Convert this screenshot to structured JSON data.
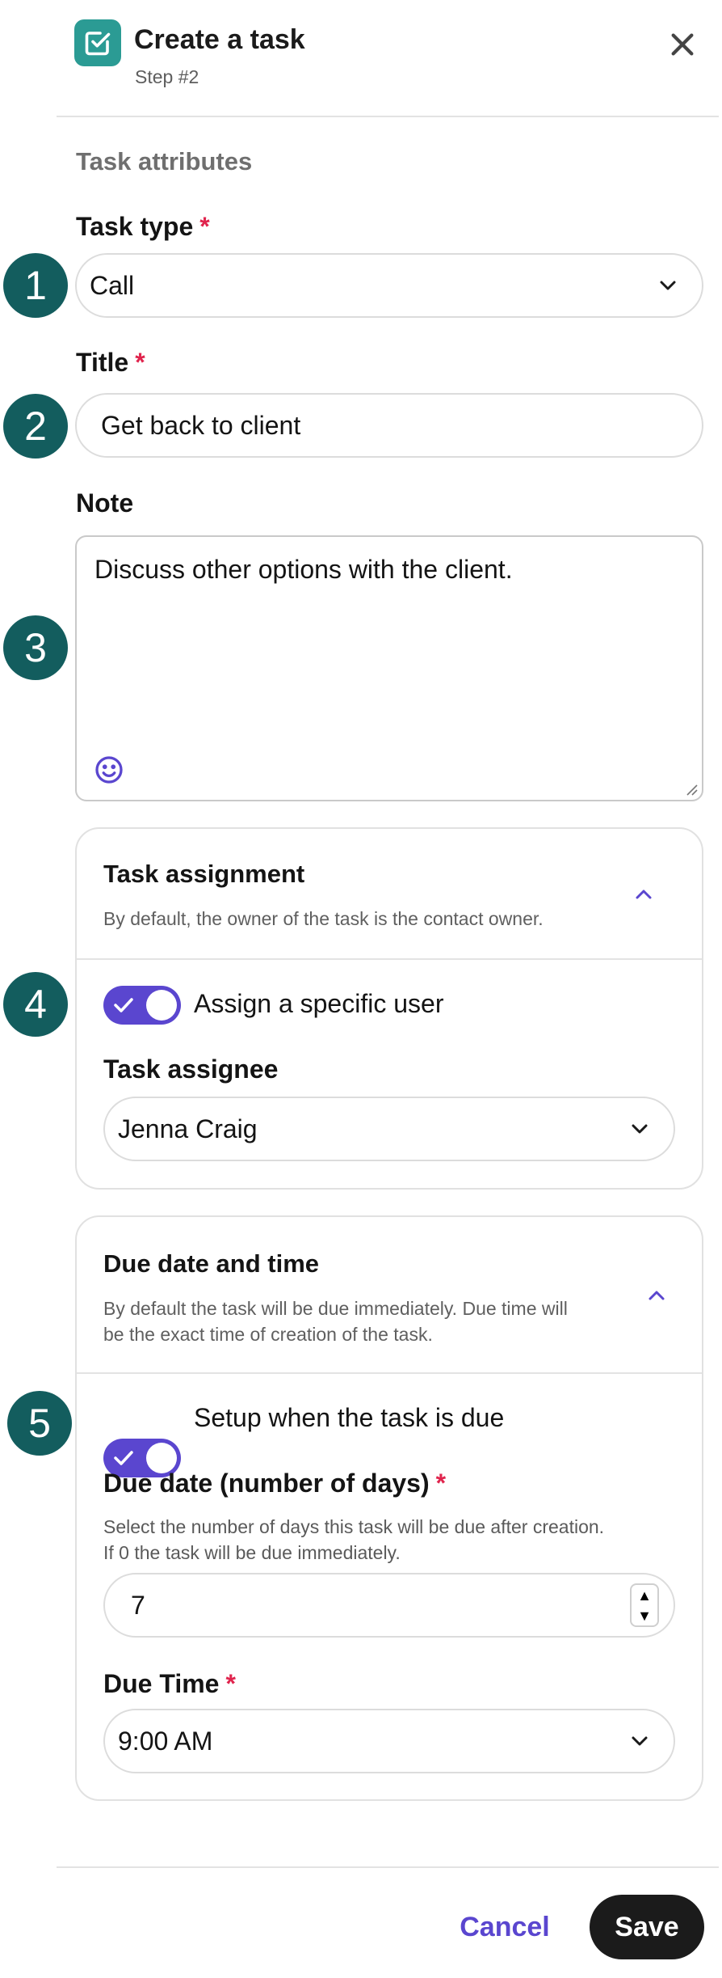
{
  "header": {
    "title": "Create a task",
    "step": "Step #2",
    "app_icon": "task-check-icon",
    "close_icon": "close-icon"
  },
  "section_title": "Task attributes",
  "steps": [
    "1",
    "2",
    "3",
    "4",
    "5"
  ],
  "task_type": {
    "label": "Task type",
    "required_mark": "*",
    "value": "Call"
  },
  "title_field": {
    "label": "Title",
    "required_mark": "*",
    "value": "Get back to client"
  },
  "note": {
    "label": "Note",
    "value": "Discuss other options with the client."
  },
  "task_assignment": {
    "title": "Task assignment",
    "description": "By default, the owner of the task is the contact owner.",
    "toggle_label": "Assign a specific user",
    "toggle_on": true,
    "assignee_label": "Task assignee",
    "assignee_value": "Jenna Craig"
  },
  "due_date_time": {
    "title": "Due date and time",
    "description_line1": "By default the task will be due immediately. Due time will",
    "description_line2": "be the exact time of creation of the task.",
    "toggle_label": "Setup when the task is due",
    "toggle_on": true,
    "due_days_label": "Due date (number of days)",
    "required_mark": "*",
    "due_days_help_line1": "Select the number of days this task will be due after creation.",
    "due_days_help_line2": "If 0 the task will be due immediately.",
    "due_days_value": "7",
    "due_time_label": "Due Time",
    "due_time_value": "9:00 AM"
  },
  "footer": {
    "cancel_label": "Cancel",
    "save_label": "Save"
  },
  "colors": {
    "accent": "#5a46cf",
    "teal": "#2b9b94",
    "step_badge": "#135d5e",
    "required": "#e0244d"
  }
}
